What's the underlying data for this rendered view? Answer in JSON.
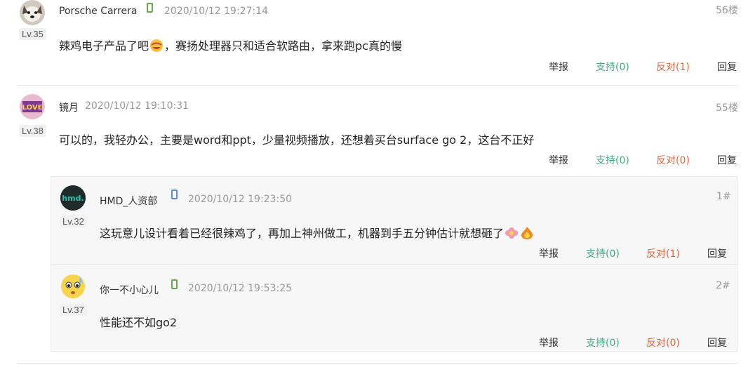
{
  "comments": [
    {
      "username": "Porsche Carrera",
      "level": "Lv.35",
      "time": "2020/10/12 19:27:14",
      "floor": "56楼",
      "content_before": "辣鸡电子产品了吧",
      "content_after": "，赛扬处理器只和适合软路由，拿来跑pc真的慢",
      "actions": {
        "report": "举报",
        "support": "支持(0)",
        "oppose": "反对(1)",
        "reply": "回复"
      }
    },
    {
      "username": "镜月",
      "level": "Lv.38",
      "time": "2020/10/12 19:10:31",
      "floor": "55楼",
      "content": "可以的，我轻办公，主要是word和ppt，少量视频播放，还想着买台surface go 2，这台不正好",
      "actions": {
        "report": "举报",
        "support": "支持(0)",
        "oppose": "反对(0)",
        "reply": "回复"
      },
      "replies": [
        {
          "username": "HMD_人资部",
          "avatar_text": "hmd.",
          "level": "Lv.32",
          "time": "2020/10/12 19:23:50",
          "floor": "1#",
          "content": "这玩意儿设计看着已经很辣鸡了，再加上神州做工，机器到手五分钟估计就想砸了",
          "actions": {
            "report": "举报",
            "support": "支持(0)",
            "oppose": "反对(1)",
            "reply": "回复"
          }
        },
        {
          "username": "你一不小心儿",
          "level": "Lv.37",
          "time": "2020/10/12 19:53:25",
          "floor": "2#",
          "content": "性能还不如go2",
          "actions": {
            "report": "举报",
            "support": "支持(0)",
            "oppose": "反对(0)",
            "reply": "回复"
          }
        }
      ]
    }
  ],
  "colors": {
    "support": "#3fae7d",
    "oppose": "#e0663e",
    "device_android": "#6aa84f",
    "device_ios": "#5b8fd9"
  }
}
